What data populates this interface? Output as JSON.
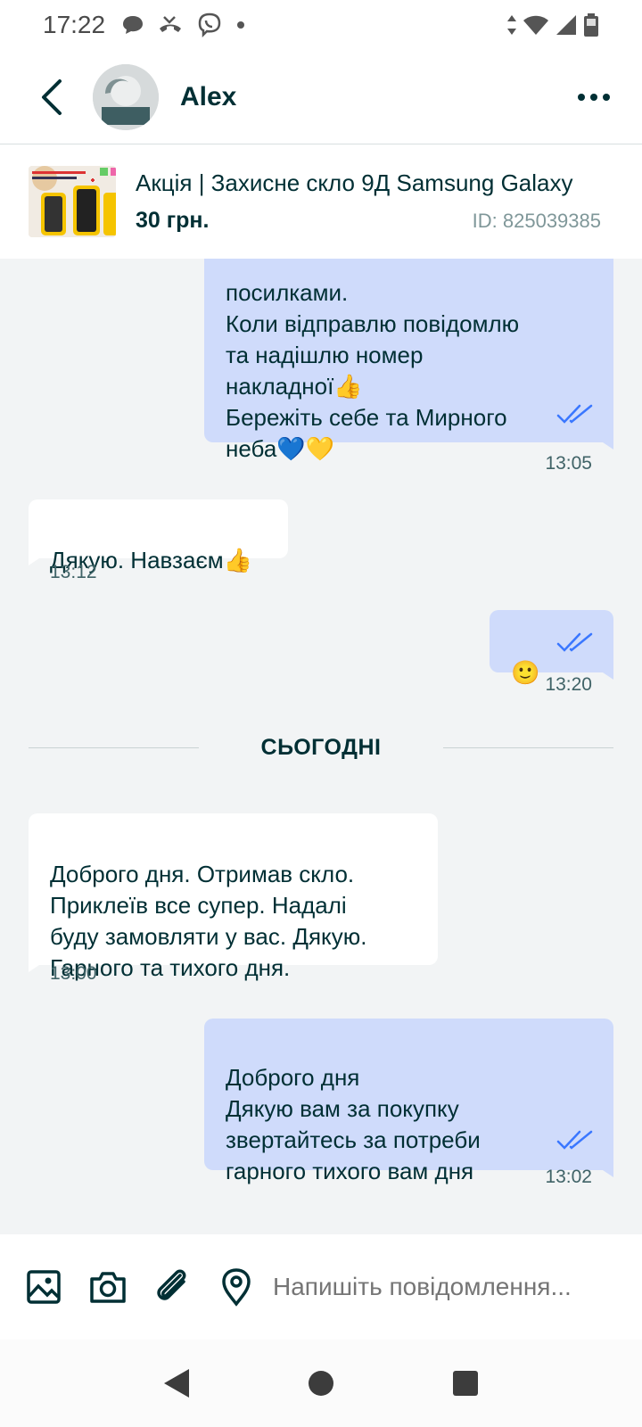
{
  "status_bar": {
    "time": "17:22"
  },
  "header": {
    "contact_name": "Alex"
  },
  "listing": {
    "title": "Акція | Захисне скло 9Д Samsung Galaxy",
    "price": "30 грн.",
    "id": "ID: 825039385"
  },
  "messages": [
    {
      "direction": "out",
      "text": "посилками.\nКоли відправлю повідомлю\nта надішлю номер\nнакладної👍\nБережіть себе та Мирного\nнеба💙💛",
      "time": "13:05",
      "read": true
    },
    {
      "direction": "in",
      "text": "Дякую. Навзаєм👍",
      "time": "13:12"
    },
    {
      "direction": "out",
      "text": "🙂",
      "time": "13:20",
      "read": true
    },
    {
      "direction": "in",
      "text": "Доброго дня. Отримав скло.\nПриклеїв все супер. Надалі\nбуду замовляти у вас. Дякую.\nГарного та тихого дня.",
      "time": "13:00"
    },
    {
      "direction": "out",
      "text": "Доброго дня\nДякую вам за покупку\nзвертайтесь за потреби\nгарного тихого вам дня",
      "time": "13:02",
      "read": true
    }
  ],
  "day_separator": "СЬОГОДНІ",
  "composer": {
    "placeholder": "Напишіть повідомлення..."
  },
  "colors": {
    "accent": "#002f34",
    "bubble_out": "#cfdbfb",
    "bubble_in": "#ffffff",
    "tick": "#3a77ff"
  }
}
